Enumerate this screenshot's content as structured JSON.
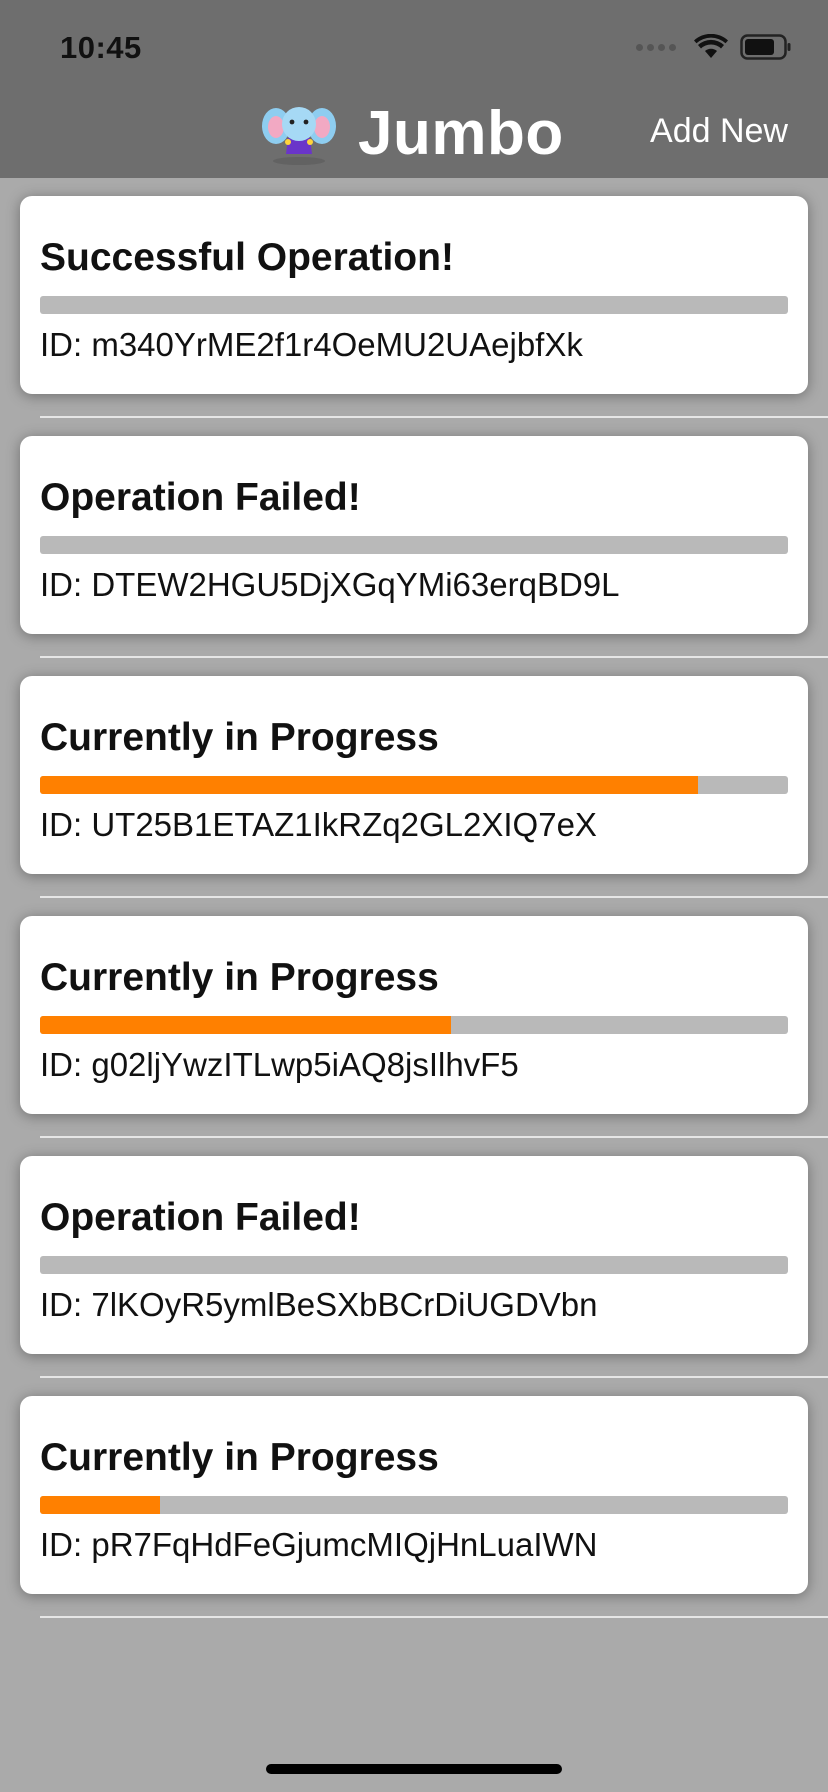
{
  "status_bar": {
    "time": "10:45",
    "icons": [
      "cellular-signal-icon",
      "wifi-icon",
      "battery-icon"
    ]
  },
  "nav": {
    "title": "Jumbo",
    "logo_icon": "elephant-mascot-icon",
    "add_new_label": "Add New"
  },
  "colors": {
    "header": "#6e6e6e",
    "background": "#aaaaaa",
    "progress_fill": "#ff8000",
    "progress_track": "#b9b9b9"
  },
  "operations": [
    {
      "title": "Successful Operation!",
      "id": "ID: m340YrME2f1r4OeMU2UAejbfXk",
      "progress": 0
    },
    {
      "title": "Operation Failed!",
      "id": "ID: DTEW2HGU5DjXGqYMi63erqBD9L",
      "progress": 0
    },
    {
      "title": "Currently in Progress",
      "id": "ID: UT25B1ETAZ1IkRZq2GL2XIQ7eX",
      "progress": 0.88
    },
    {
      "title": "Currently in Progress",
      "id": "ID: g02ljYwzITLwp5iAQ8jsIlhvF5",
      "progress": 0.55
    },
    {
      "title": "Operation Failed!",
      "id": "ID: 7lKOyR5ymlBeSXbBCrDiUGDVbn",
      "progress": 0
    },
    {
      "title": "Currently in Progress",
      "id": "ID: pR7FqHdFeGjumcMIQjHnLuaIWN",
      "progress": 0.16
    }
  ]
}
